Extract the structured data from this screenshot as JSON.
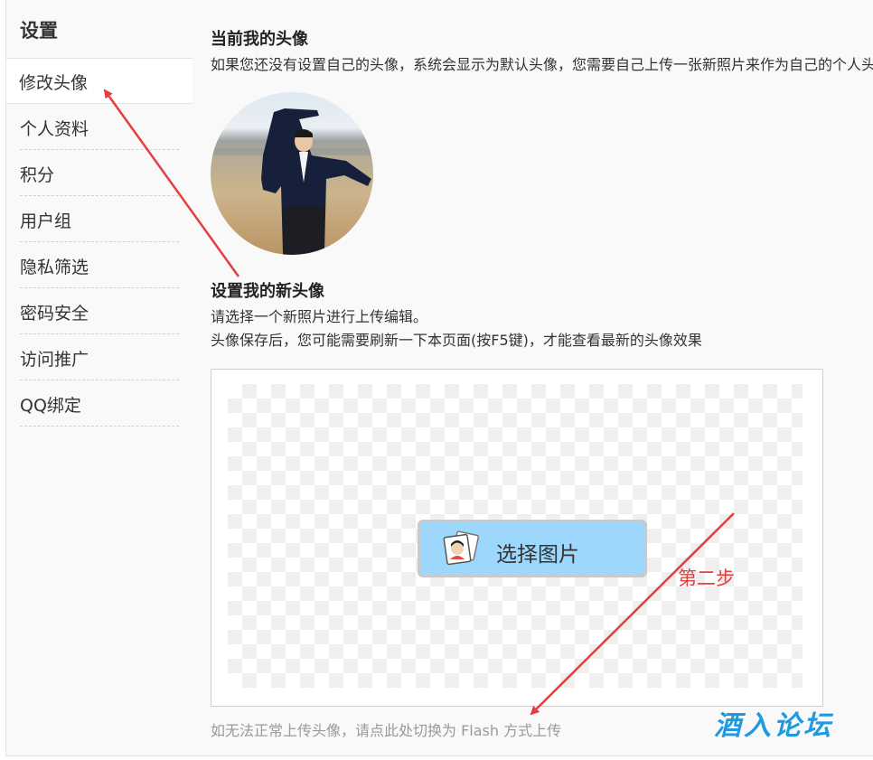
{
  "sidebar": {
    "title": "设置",
    "active_item": "修改头像",
    "items": [
      "个人资料",
      "积分",
      "用户组",
      "隐私筛选",
      "密码安全",
      "访问推广",
      "QQ绑定"
    ]
  },
  "current_avatar": {
    "heading": "当前我的头像",
    "description": "如果您还没有设置自己的头像，系统会显示为默认头像，您需要自己上传一张新照片来作为自己的个人头像"
  },
  "new_avatar": {
    "heading": "设置我的新头像",
    "instruction_1": "请选择一个新照片进行上传编辑。",
    "instruction_2": "头像保存后，您可能需要刷新一下本页面(按F5键)，才能查看最新的头像效果"
  },
  "uploader": {
    "select_button_label": "选择图片",
    "flash_switch_link": "如无法正常上传头像，请点此处切换为 Flash 方式上传"
  },
  "annotation": {
    "step_label": "第二步",
    "color": "#e53e3e"
  },
  "watermark": "酒入论坛",
  "colors": {
    "button_fill": "#9dd7fb",
    "watermark": "#1e9be0"
  }
}
